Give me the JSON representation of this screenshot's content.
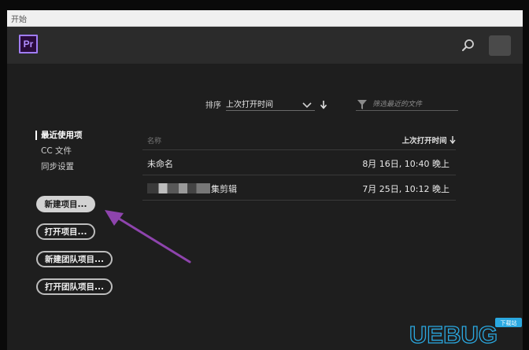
{
  "window": {
    "title": "开始"
  },
  "app": {
    "logo_text": "Pr"
  },
  "header": {
    "search_icon": "search-icon",
    "avatar": "avatar"
  },
  "sort": {
    "label": "排序",
    "selected": "上次打开时间",
    "direction_icon": "arrow-down-icon"
  },
  "filter": {
    "placeholder": "筛选最近的文件",
    "icon": "funnel-icon"
  },
  "nav": {
    "items": [
      {
        "label": "最近使用项",
        "active": true
      },
      {
        "label": "CC 文件",
        "active": false
      },
      {
        "label": "同步设置",
        "active": false
      }
    ]
  },
  "actions": {
    "new_project": "新建项目...",
    "open_project": "打开项目...",
    "new_team_project": "新建团队项目...",
    "open_team_project": "打开团队项目..."
  },
  "table": {
    "col_name": "名称",
    "col_date": "上次打开时间",
    "rows": [
      {
        "name": "未命名",
        "date": "8月 16日, 10:40 晚上"
      },
      {
        "name": "集剪辑",
        "date": "7月 25日, 10:12 晚上"
      }
    ]
  },
  "watermark": {
    "text": "UEBUG",
    "badge": "下载站",
    "accent_color": "#2aa8e0"
  },
  "colors": {
    "accent_purple": "#a07cf6",
    "annotation_arrow": "#8e44ad"
  }
}
